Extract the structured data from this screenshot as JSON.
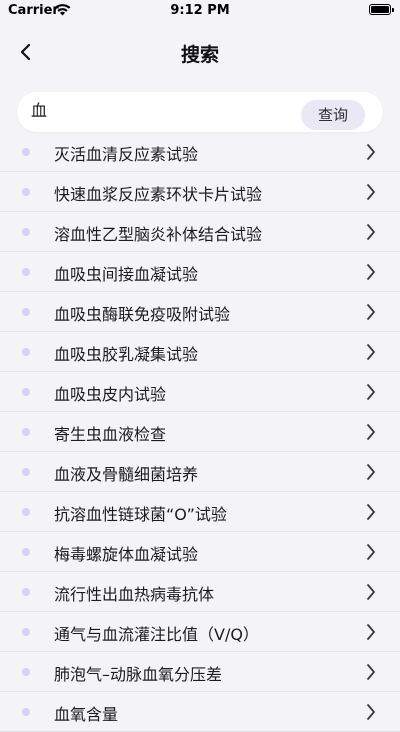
{
  "status_bar": {
    "carrier": "Carrier",
    "time": "9:12 PM"
  },
  "nav": {
    "title": "搜索"
  },
  "search": {
    "value": "血",
    "button_label": "查询"
  },
  "results": [
    "灭活血清反应素试验",
    "快速血浆反应素环状卡片试验",
    "溶血性乙型脑炎补体结合试验",
    "血吸虫间接血凝试验",
    "血吸虫酶联免疫吸附试验",
    "血吸虫胶乳凝集试验",
    "血吸虫皮内试验",
    "寄生虫血液检查",
    "血液及骨髓细菌培养",
    "抗溶血性链球菌“O”试验",
    "梅毒螺旋体血凝试验",
    "流行性出血热病毒抗体",
    "通气与血流灌注比值（V/Q）",
    "肺泡气–动脉血氧分压差",
    "血氧含量"
  ],
  "colors": {
    "bullet": "#d4d2f0",
    "button_bg": "#e9e8f4",
    "background": "#f3f3f8"
  }
}
